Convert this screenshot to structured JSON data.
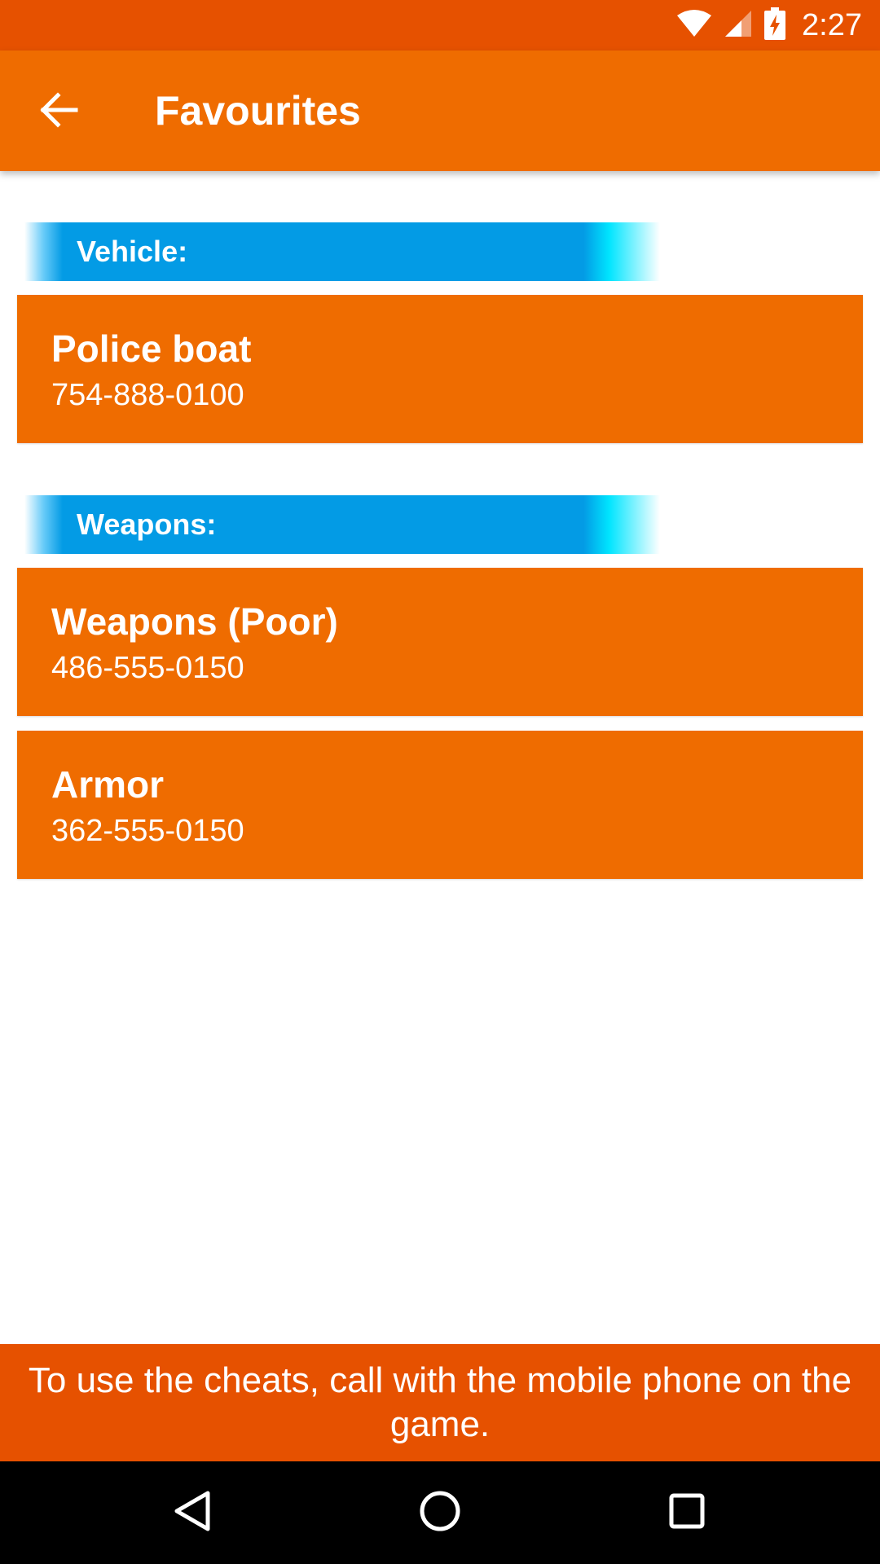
{
  "status_bar": {
    "time": "2:27",
    "icons": [
      "wifi-icon",
      "signal-icon",
      "battery-charging-icon"
    ]
  },
  "app_bar": {
    "title": "Favourites",
    "back_icon": "arrow-left-icon"
  },
  "sections": [
    {
      "label": "Vehicle:",
      "cheats": [
        {
          "name": "Police boat",
          "code": "754-888-0100"
        }
      ]
    },
    {
      "label": "Weapons:",
      "cheats": [
        {
          "name": "Weapons (Poor)",
          "code": "486-555-0150"
        },
        {
          "name": "Armor",
          "code": "362-555-0150"
        }
      ]
    }
  ],
  "banner": {
    "text": "To use the cheats, call with the mobile phone on the game."
  },
  "nav_bar": {
    "icons": [
      "back-triangle-icon",
      "home-circle-icon",
      "recents-square-icon"
    ]
  },
  "colors": {
    "status_bar": "#e65100",
    "app_bar": "#ef6c00",
    "card": "#ef6c00",
    "section_header": "#039be5",
    "banner": "#e65100",
    "nav_bar": "#000000"
  }
}
